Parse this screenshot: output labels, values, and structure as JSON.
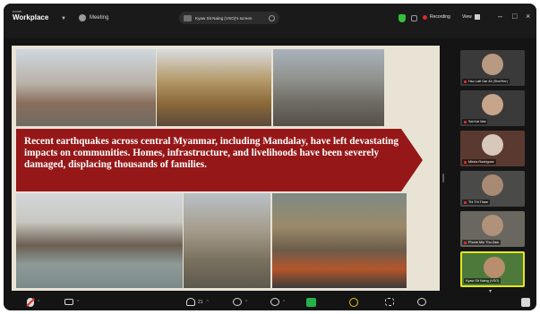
{
  "app": {
    "brand_small": "zoom",
    "brand_main": "Workplace",
    "meeting_label": "Meeting"
  },
  "share": {
    "label": "Kyaw Sit Naing (VSO)'s screen"
  },
  "status": {
    "recording": "Recording",
    "view": "View"
  },
  "slide": {
    "banner_text": "Recent earthquakes across central Myanmar, including Mandalay, have left devastating impacts on communities. Homes, infrastructure, and livelihoods have been severely damaged, displacing thousands of families."
  },
  "participants": [
    {
      "name": "Hsu Latt Gal 43 (She/Her)",
      "active": false,
      "muted": true
    },
    {
      "name": "Sai Kal Wai",
      "active": false,
      "muted": true
    },
    {
      "name": "Mirela Rodriguez",
      "active": false,
      "muted": true
    },
    {
      "name": "Thi Thi Thaw",
      "active": false,
      "muted": true
    },
    {
      "name": "Phone Min Thu Zaw",
      "active": false,
      "muted": true
    },
    {
      "name": "Kyaw Sit Naing (VSO)",
      "active": true,
      "muted": false
    }
  ],
  "toolbar": {
    "participants_count": "21"
  },
  "colors": {
    "banner": "#961718",
    "active_speaker_border": "#e6e61a",
    "share_button": "#25b24a",
    "recording_dot": "#e02828"
  }
}
